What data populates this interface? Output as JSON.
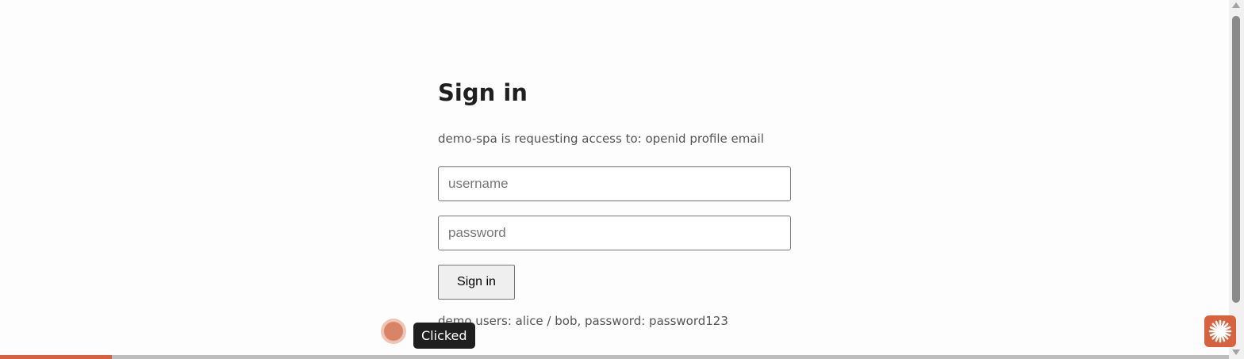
{
  "form": {
    "title": "Sign in",
    "subtitle": "demo-spa is requesting access to: openid profile email",
    "username_placeholder": "username",
    "password_placeholder": "password",
    "submit_label": "Sign in",
    "hint": "demo users: alice / bob, password: password123"
  },
  "overlay": {
    "tooltip": "Clicked",
    "fab_icon": "sparkle-icon",
    "accent_color": "#d9623e"
  },
  "progress": {
    "fraction": 0.091
  }
}
